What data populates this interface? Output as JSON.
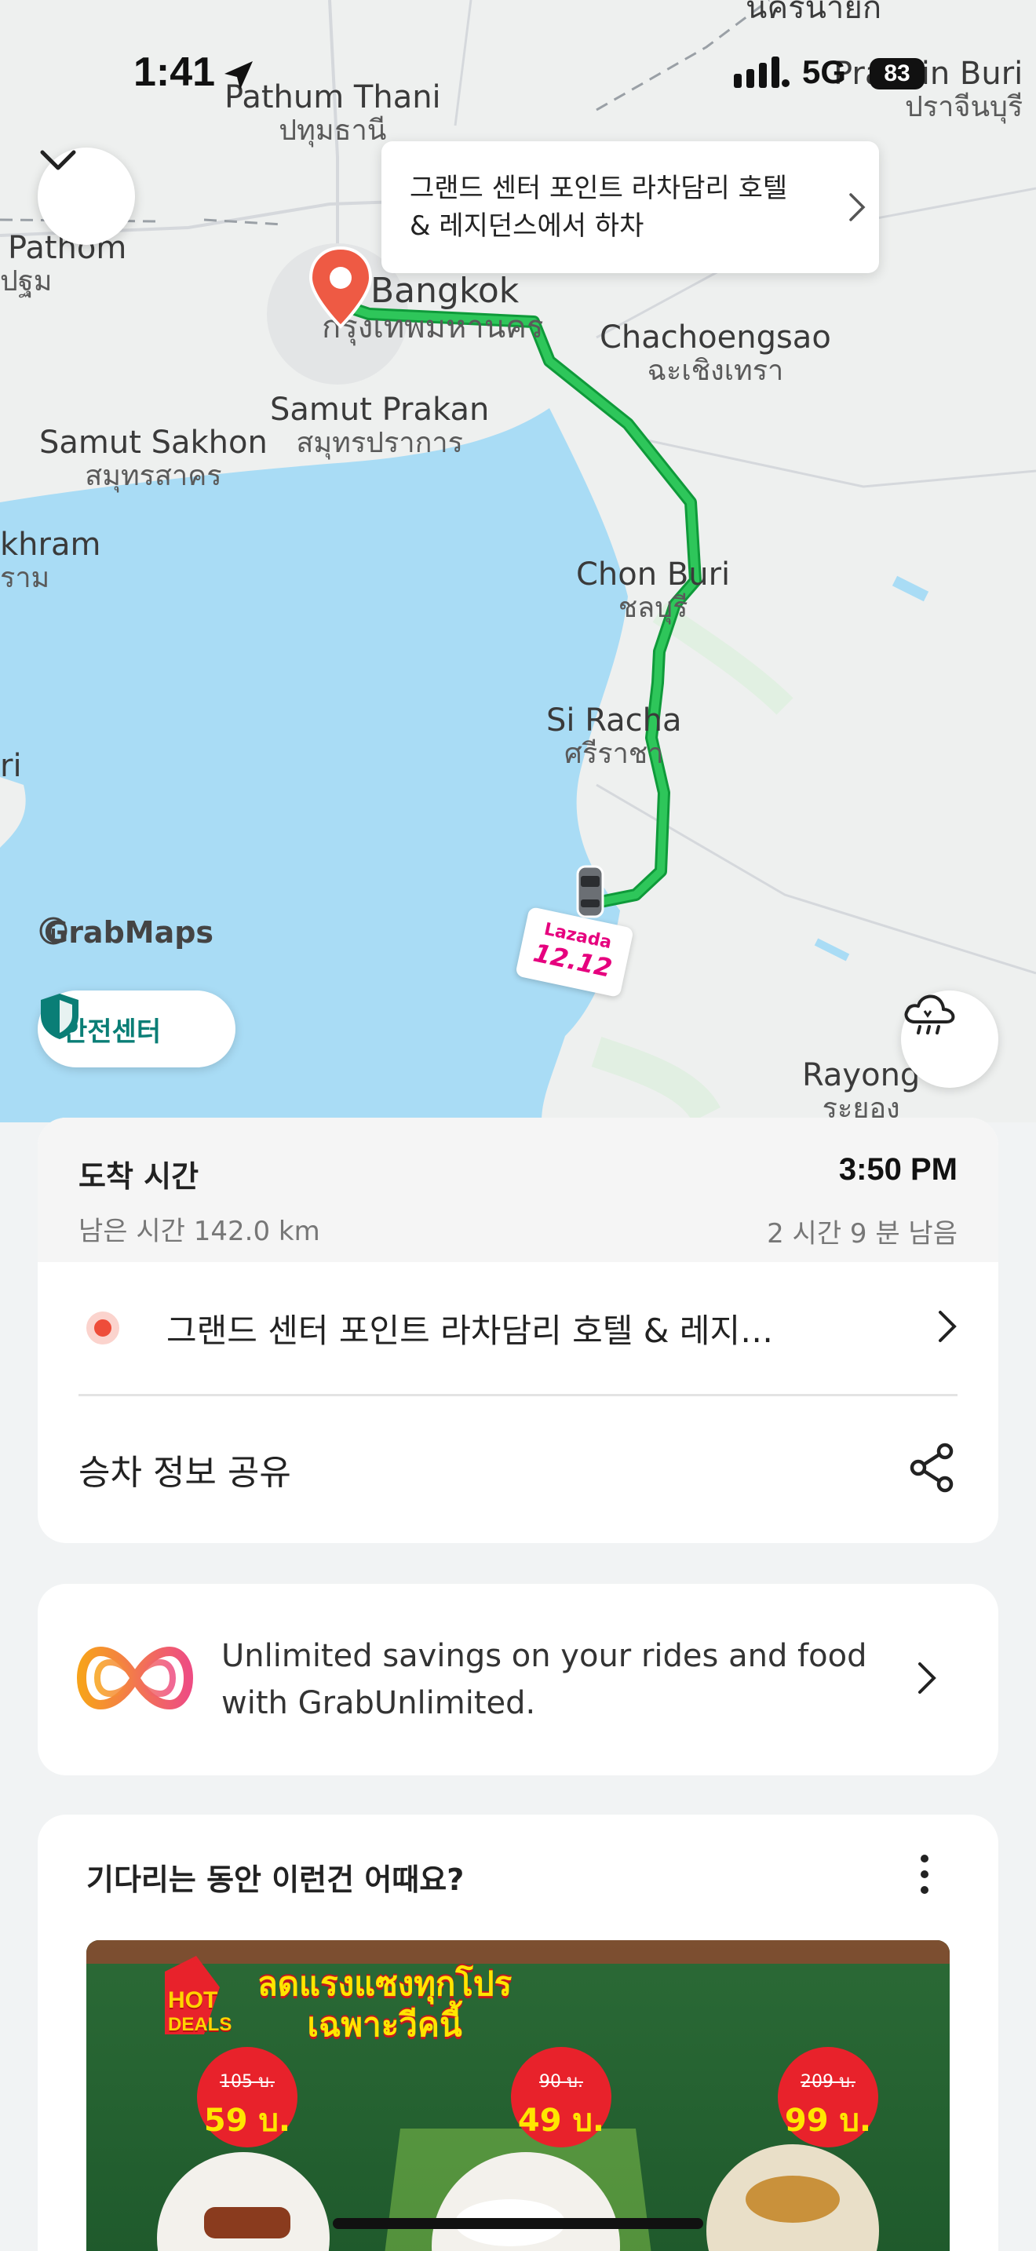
{
  "status_bar": {
    "time": "1:41",
    "network": "5G",
    "battery": "83"
  },
  "map": {
    "labels": [
      {
        "en": "นครนายก",
        "th": ""
      },
      {
        "en": "Pathum Thani",
        "th": "ปทุมธานี"
      },
      {
        "en": "Chachoengsao",
        "th": "ฉะเชิงเทรา"
      },
      {
        "en": "Bangkok",
        "th": "กรุงเทพมหานคร"
      },
      {
        "en": "Samut Prakan",
        "th": "สมุทรปราการ"
      },
      {
        "en": "Samut Sakhon",
        "th": "สมุทรสาคร"
      },
      {
        "en": "Chon Buri",
        "th": "ชลบุรี"
      },
      {
        "en": "Si Racha",
        "th": "ศรีราชา"
      },
      {
        "en": "Rayong",
        "th": "ระยอง"
      },
      {
        "en": "Pathom",
        "th": "ปฐม"
      },
      {
        "en": "khram",
        "th": "ราม"
      },
      {
        "en": "Prachin Buri",
        "th": "ปราจีนบุรี"
      },
      {
        "en": "ri",
        "th": ""
      }
    ],
    "dropoff_tooltip": "그랜드 센터 포인트 라차담리 호텔 & 레지던스에서 하차",
    "attribution": "GrabMaps",
    "promo": {
      "brand": "Lazada",
      "date": "12.12"
    },
    "safety_label": "안전센터",
    "icons": [
      "chevron-down-icon",
      "location-pin-icon",
      "car-icon",
      "shield-icon",
      "weather-icon",
      "info-icon",
      "location-arrow-icon"
    ],
    "colors": {
      "route": "#1fb14a",
      "water": "#a9dcf5",
      "land": "#eef0ef",
      "pin": "#ee5a44"
    }
  },
  "eta": {
    "label": "도착 시간",
    "distance": "남은 시간 142.0 km",
    "time": "3:50 PM",
    "remaining": "2 시간 9 분 남음"
  },
  "destination": {
    "text": "그랜드 센터 포인트 라차담리 호텔 & 레지…"
  },
  "share": {
    "label": "승차 정보 공유"
  },
  "unlimited": {
    "text": "Unlimited savings on your rides and food with GrabUnlimited."
  },
  "suggestion": {
    "title": "기다리는 동안 이런건 어때요?",
    "banner": {
      "hot": "HOT",
      "deals": "DEALS",
      "headline1": "ลดแรงแซงทุกโปร",
      "headline2": "เฉพาะวีคนี้",
      "offers": [
        {
          "old": "105 บ.",
          "new": "59 บ."
        },
        {
          "old": "90 บ.",
          "new": "49 บ."
        },
        {
          "old": "209 บ.",
          "new": "99 บ."
        }
      ]
    }
  }
}
